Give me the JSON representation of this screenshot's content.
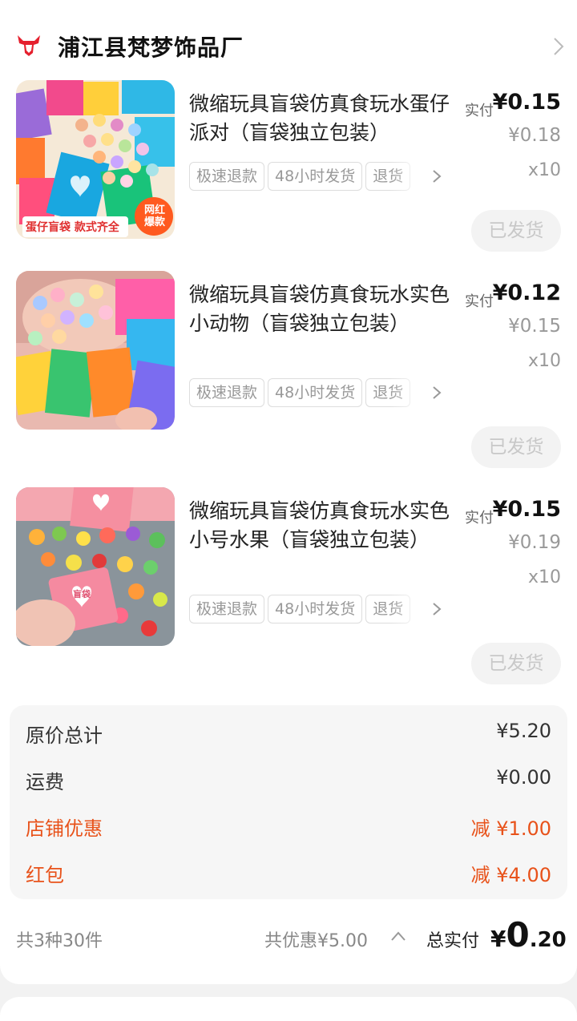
{
  "shop": {
    "name": "浦江县梵梦饰品厂",
    "logo_icon": "bull-head-icon",
    "chevron_icon": "chevron-right-icon"
  },
  "items": [
    {
      "title": "微缩玩具盲袋仿真食玩水蛋仔派对（盲袋独立包装）",
      "image": {
        "badge1": "蛋仔盲袋 款式齐全",
        "badge2": "网红爆款"
      },
      "tags": [
        "极速退款",
        "48小时发货",
        "退货"
      ],
      "price_label": "实付",
      "price_now": "¥0.15",
      "price_orig": "¥0.18",
      "qty": "x10",
      "status": "已发货"
    },
    {
      "title": "微缩玩具盲袋仿真食玩水实色小动物（盲袋独立包装）",
      "tags": [
        "极速退款",
        "48小时发货",
        "退货"
      ],
      "price_label": "实付",
      "price_now": "¥0.12",
      "price_orig": "¥0.15",
      "qty": "x10",
      "status": "已发货"
    },
    {
      "title": "微缩玩具盲袋仿真食玩水实色小号水果（盲袋独立包装）",
      "image": {
        "bag_label": "盲袋"
      },
      "tags": [
        "极速退款",
        "48小时发货",
        "退货"
      ],
      "price_label": "实付",
      "price_now": "¥0.15",
      "price_orig": "¥0.19",
      "qty": "x10",
      "status": "已发货"
    }
  ],
  "summary": {
    "original_total_label": "原价总计",
    "original_total_value": "¥5.20",
    "shipping_label": "运费",
    "shipping_value": "¥0.00",
    "shop_discount_label": "店铺优惠",
    "shop_discount_value": "减 ¥1.00",
    "red_packet_label": "红包",
    "red_packet_value": "减 ¥4.00"
  },
  "footer": {
    "count": "共3种30件",
    "discount": "共优惠¥5.00",
    "total_label": "总实付",
    "total_symbol": "¥",
    "total_int": "0",
    "total_dec": ".20"
  },
  "colors": {
    "accent_red": "#e8521a",
    "logo_red": "#e5202e"
  }
}
